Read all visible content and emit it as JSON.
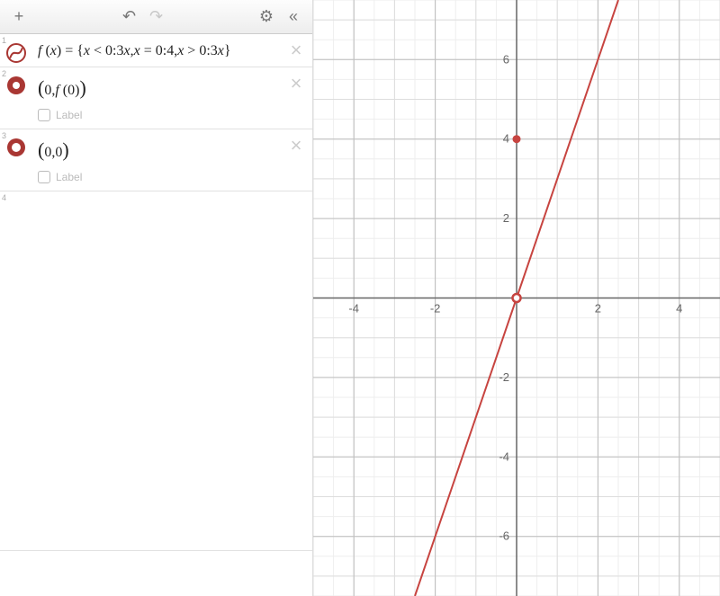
{
  "toolbar": {
    "add": "+",
    "undo": "↶",
    "redo": "↷",
    "settings": "⚙",
    "collapse": "«"
  },
  "expressions": [
    {
      "index": "1",
      "kind": "function",
      "formula": "f ( x ) = { x < 0 : 3x, x = 0 : 4, x > 0 : 3x }",
      "delete": "×"
    },
    {
      "index": "2",
      "kind": "point-filled",
      "formula": "( 0, f ( 0 ) )",
      "label_option": "Label",
      "delete": "×"
    },
    {
      "index": "3",
      "kind": "point-open",
      "formula": "( 0, 0 )",
      "label_option": "Label",
      "delete": "×"
    },
    {
      "index": "4",
      "kind": "empty"
    }
  ],
  "chart_data": {
    "type": "line",
    "title": "",
    "xlim": [
      -5,
      5
    ],
    "ylim": [
      -7.5,
      7.5
    ],
    "xticks": [
      -4,
      -2,
      2,
      4
    ],
    "yticks": [
      -6,
      -4,
      -2,
      2,
      4,
      6
    ],
    "series": [
      {
        "name": "f(x)=3x (piecewise, x≠0)",
        "x": [
          -2.5,
          -2,
          -1,
          0,
          1,
          2,
          2.5
        ],
        "y": [
          -7.5,
          -6,
          -3,
          0,
          3,
          6,
          7.5
        ]
      }
    ],
    "points": [
      {
        "name": "(0,f(0))",
        "x": 0,
        "y": 4,
        "style": "filled",
        "color": "#c74440"
      },
      {
        "name": "(0,0)",
        "x": 0,
        "y": 0,
        "style": "open",
        "color": "#c74440"
      }
    ],
    "line_color": "#c74440",
    "grid": true
  }
}
